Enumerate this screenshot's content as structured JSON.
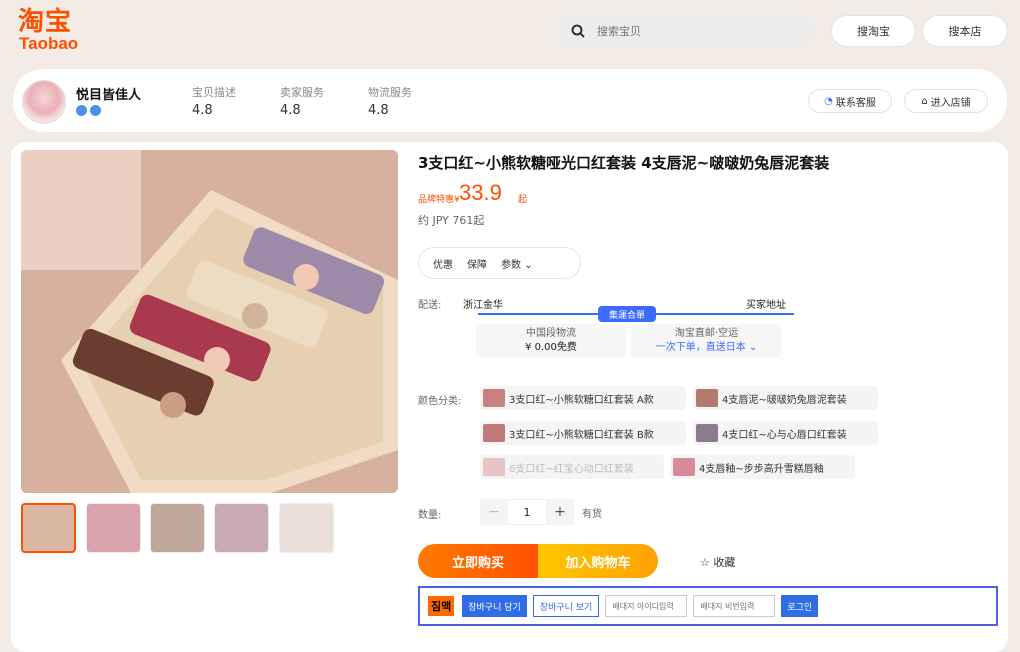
{
  "header": {
    "logo_cn": "淘宝",
    "logo_en": "Taobao",
    "search_placeholder": "搜索宝贝",
    "btn_search_taobao": "搜淘宝",
    "btn_search_store": "搜本店"
  },
  "shop": {
    "name": "悦目皆佳人",
    "ratings": [
      {
        "label": "宝贝描述",
        "value": "4.8"
      },
      {
        "label": "卖家服务",
        "value": "4.8"
      },
      {
        "label": "物流服务",
        "value": "4.8"
      }
    ],
    "contact_label": "联系客服",
    "enter_label": "进入店铺"
  },
  "product": {
    "title": "3支口红~小熊软糖哑光口红套装 4支唇泥~啵啵奶兔唇泥套装",
    "price_label": "品牌特惠¥",
    "price": "33.9",
    "price_unit": "起",
    "jpy": "约 JPY 761起",
    "tabs": [
      "优惠",
      "保障",
      "参数"
    ],
    "delivery": {
      "label": "配送:",
      "from": "浙江金华",
      "to": "买家地址",
      "tag": "集運合單",
      "box1_line1": "中国段物流",
      "box1_line2": "¥ 0.00免费",
      "box2_line1": "淘宝直邮·空运",
      "box2_line2": "一次下单，直送日本"
    },
    "color_label": "颜色分类:",
    "options": [
      {
        "label": "3支口红~小熊软糖口红套装 A款",
        "swatch": "#c98080"
      },
      {
        "label": "4支唇泥~啵啵奶兔唇泥套装",
        "swatch": "#b57a6e"
      },
      {
        "label": "3支口红~小熊软糖口红套装 B款",
        "swatch": "#c07a7a"
      },
      {
        "label": "4支口红~心与心唇口红套装",
        "swatch": "#8a7c8c"
      },
      {
        "label": "6支口红~红宝心动口红套装",
        "swatch": "#d99d9d"
      },
      {
        "label": "4支唇釉~步步高升雪糕唇釉",
        "swatch": "#d68a9a"
      }
    ],
    "qty_label": "数量:",
    "qty_value": "1",
    "stock": "有货",
    "buy_now": "立即购买",
    "add_cart": "加入购物车",
    "favorite": "收藏"
  },
  "plugin": {
    "logo": "짐맥",
    "btn_add": "장바구니 담기",
    "btn_view": "장바구니 보기",
    "input_id": "배대지 아이디입력",
    "input_pw": "배대지 비번입력",
    "login": "로그인"
  },
  "colors": {
    "brand": "#ff5000",
    "accent": "#3d6bff"
  }
}
